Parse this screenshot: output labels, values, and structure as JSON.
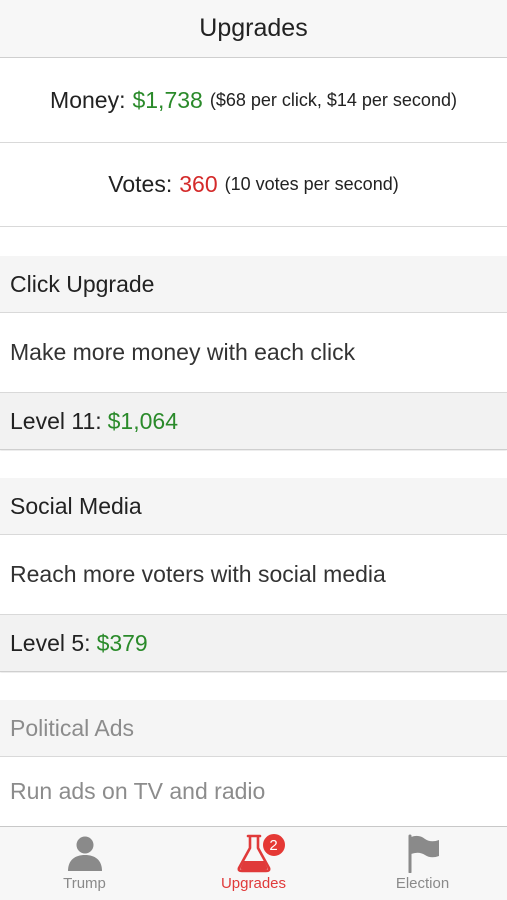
{
  "header": {
    "title": "Upgrades"
  },
  "stats": {
    "money": {
      "label": "Money:",
      "value": "$1,738",
      "note": "($68 per click, $14 per second)"
    },
    "votes": {
      "label": "Votes:",
      "value": "360",
      "note": "(10 votes per second)"
    }
  },
  "upgrades": [
    {
      "name": "Click Upgrade",
      "description": "Make more money with each click",
      "level_label": "Level 11:",
      "cost": "$1,064",
      "available": true
    },
    {
      "name": "Social Media",
      "description": "Reach more voters with social media",
      "level_label": "Level 5:",
      "cost": "$379",
      "available": true
    },
    {
      "name": "Political Ads",
      "description": "Run ads on TV and radio",
      "available": false
    }
  ],
  "tabs": [
    {
      "label": "Trump",
      "icon": "person-icon",
      "active": false
    },
    {
      "label": "Upgrades",
      "icon": "flask-icon",
      "active": true,
      "badge": "2"
    },
    {
      "label": "Election",
      "icon": "flag-icon",
      "active": false
    }
  ],
  "colors": {
    "money": "#2a8a2a",
    "votes": "#d42a2a",
    "active_tab": "#e03a3a",
    "inactive_tab": "#8a8a8a",
    "badge": "#e53935"
  }
}
